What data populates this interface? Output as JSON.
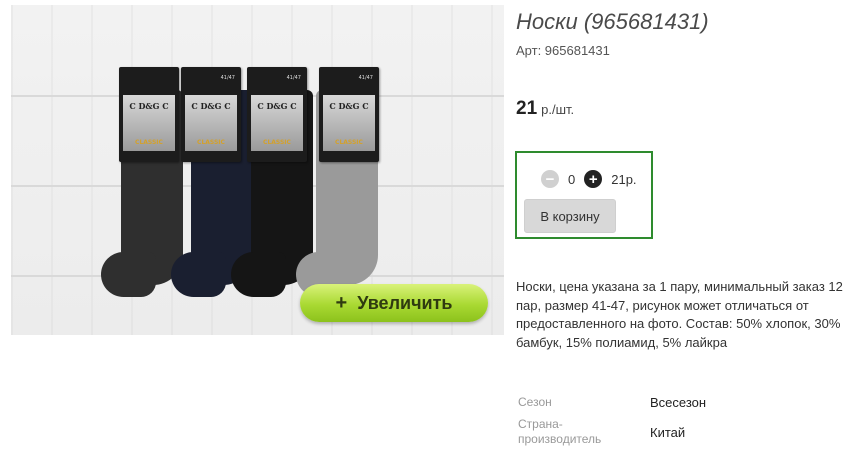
{
  "product": {
    "title": "Носки (965681431)",
    "sku": "Арт: 965681431",
    "price_amount": "21",
    "price_unit": "р./шт."
  },
  "photo": {
    "brand_label": "C D&G C",
    "series_label": "CLASSIC",
    "size_label": "41/47",
    "zoom_button": {
      "icon": "+",
      "label": "Увеличить"
    }
  },
  "cart": {
    "minus_icon": "−",
    "plus_icon": "+",
    "quantity": "0",
    "total": "21р.",
    "add_button": "В корзину"
  },
  "description": "Носки, цена указана за 1 пару, минимальный заказ 12 пар, размер 41-47, рисунок может отличаться от предоставленного на фото. Состав: 50% хлопок, 30% бамбук, 15% полиамид, 5% лайкра",
  "attributes": [
    {
      "label": "Сезон",
      "value": "Всесезон"
    },
    {
      "label": "Страна-производитель",
      "value": "Китай"
    }
  ],
  "colors": {
    "cart_border": "#2e8b2e",
    "zoom_button": "#a9d932",
    "sock_charcoal": "#2f2f2f",
    "sock_navy": "#1a1f30",
    "sock_black": "#151515",
    "sock_gray": "#9a9a9a"
  }
}
